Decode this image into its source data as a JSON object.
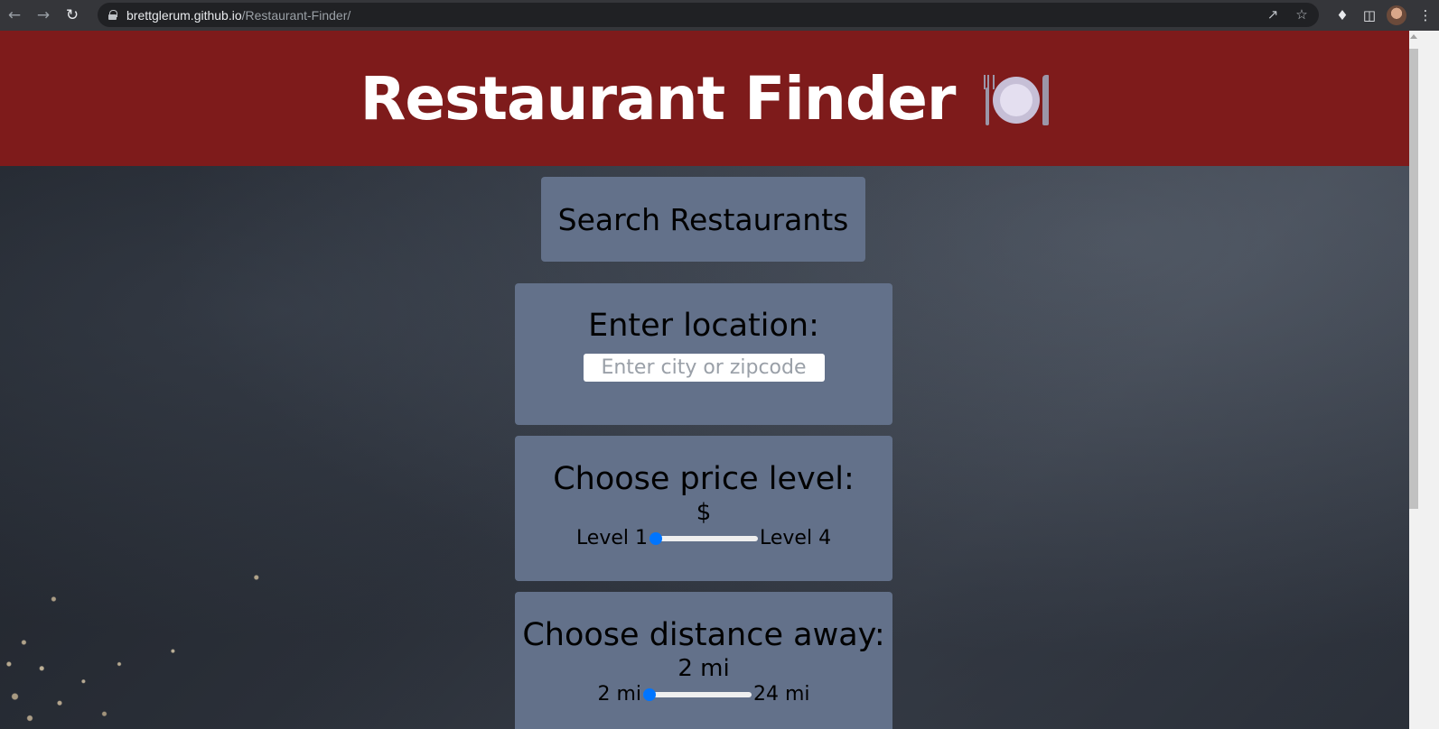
{
  "browser": {
    "url_host": "brettglerum.github.io",
    "url_path": "/Restaurant-Finder/"
  },
  "header": {
    "title": "Restaurant Finder",
    "icon": "fork-knife-plate-icon"
  },
  "search": {
    "button_label": "Search Restaurants"
  },
  "location": {
    "title": "Enter location:",
    "placeholder": "Enter city or zipcode",
    "value": ""
  },
  "price": {
    "title": "Choose price level:",
    "value": "$",
    "min_label": "Level 1",
    "max_label": "Level 4",
    "level": 1,
    "min": 1,
    "max": 4
  },
  "distance": {
    "title": "Choose distance away:",
    "value": "2 mi",
    "min_label": "2 mi",
    "max_label": "24 mi",
    "miles": 2,
    "min": 2,
    "max": 24
  },
  "colors": {
    "header_bg": "#7e1b1b",
    "card_bg": "#63718a",
    "slider_thumb": "#0075ff"
  }
}
